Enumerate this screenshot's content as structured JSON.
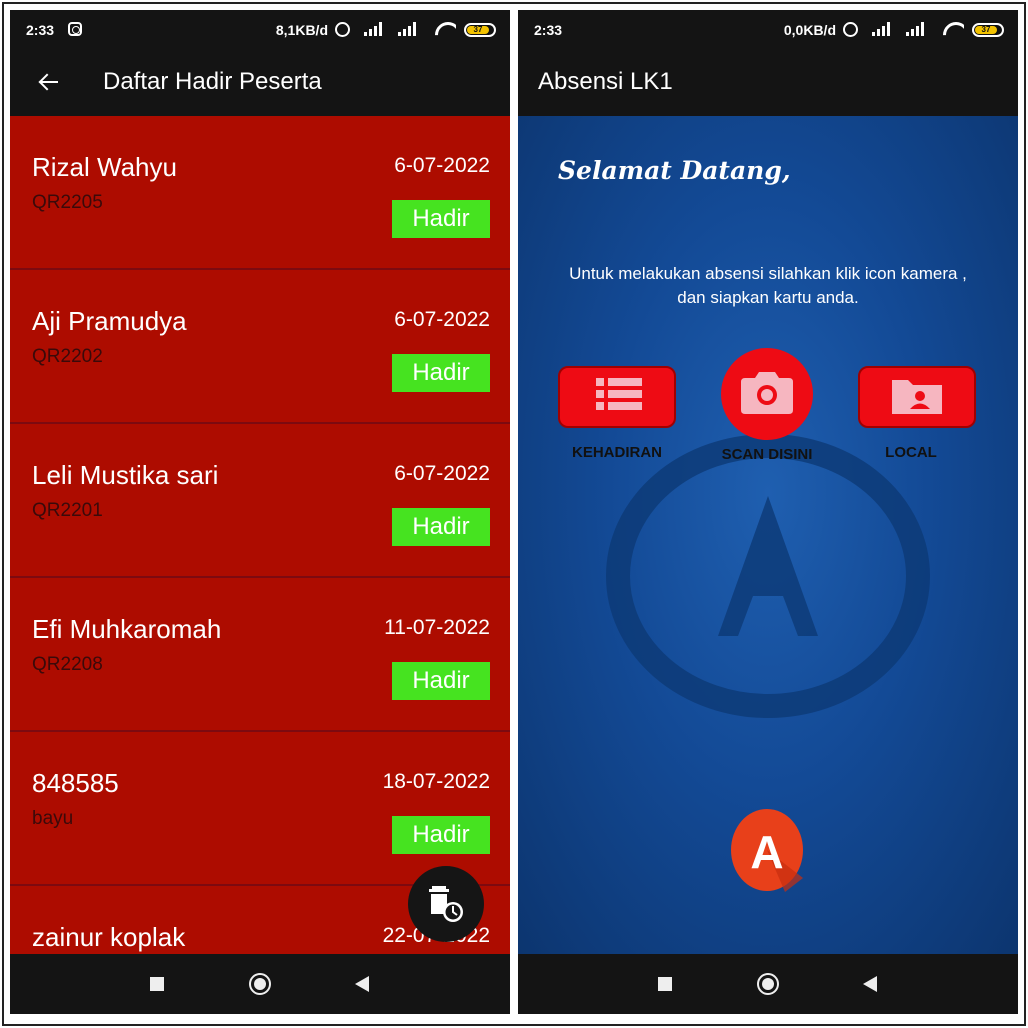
{
  "left_screen": {
    "status": {
      "time": "2:33",
      "speed": "8,1KB/d",
      "battery": "37"
    },
    "appbar": {
      "title": "Daftar Hadir Peserta",
      "back_icon": "arrow-left-icon"
    },
    "rows": [
      {
        "name": "Rizal Wahyu",
        "code": "QR2205",
        "date": "6-07-2022",
        "status": "Hadir"
      },
      {
        "name": "Aji Pramudya",
        "code": "QR2202",
        "date": "6-07-2022",
        "status": "Hadir"
      },
      {
        "name": "Leli Mustika sari",
        "code": "QR2201",
        "date": "6-07-2022",
        "status": "Hadir"
      },
      {
        "name": "Efi Muhkaromah",
        "code": "QR2208",
        "date": "11-07-2022",
        "status": "Hadir"
      },
      {
        "name": "848585",
        "code": "bayu",
        "date": "18-07-2022",
        "status": "Hadir"
      },
      {
        "name": "zainur koplak",
        "code": "",
        "date": "22-07-2022",
        "status": ""
      }
    ],
    "fab_icon": "delete-history-icon",
    "colors": {
      "row_bg": "#ad0c00",
      "badge": "#46e320",
      "bar": "#141414"
    }
  },
  "right_screen": {
    "status": {
      "time": "2:33",
      "speed": "0,0KB/d",
      "battery": "37"
    },
    "appbar": {
      "title": "Absensi LK1"
    },
    "welcome": "Selamat Datang,",
    "instructions": "Untuk melakukan absensi silahkan klik icon kamera , dan  siapkan kartu anda.",
    "buttons": {
      "kehadiran": {
        "label": "KEHADIRAN",
        "icon": "list-icon"
      },
      "scan": {
        "label": "SCAN DISINI",
        "icon": "camera-icon"
      },
      "local": {
        "label": "LOCAL",
        "icon": "folder-user-icon"
      }
    },
    "logo_letter": "A",
    "colors": {
      "button": "#ee0b14",
      "bg": "#134a96"
    }
  }
}
